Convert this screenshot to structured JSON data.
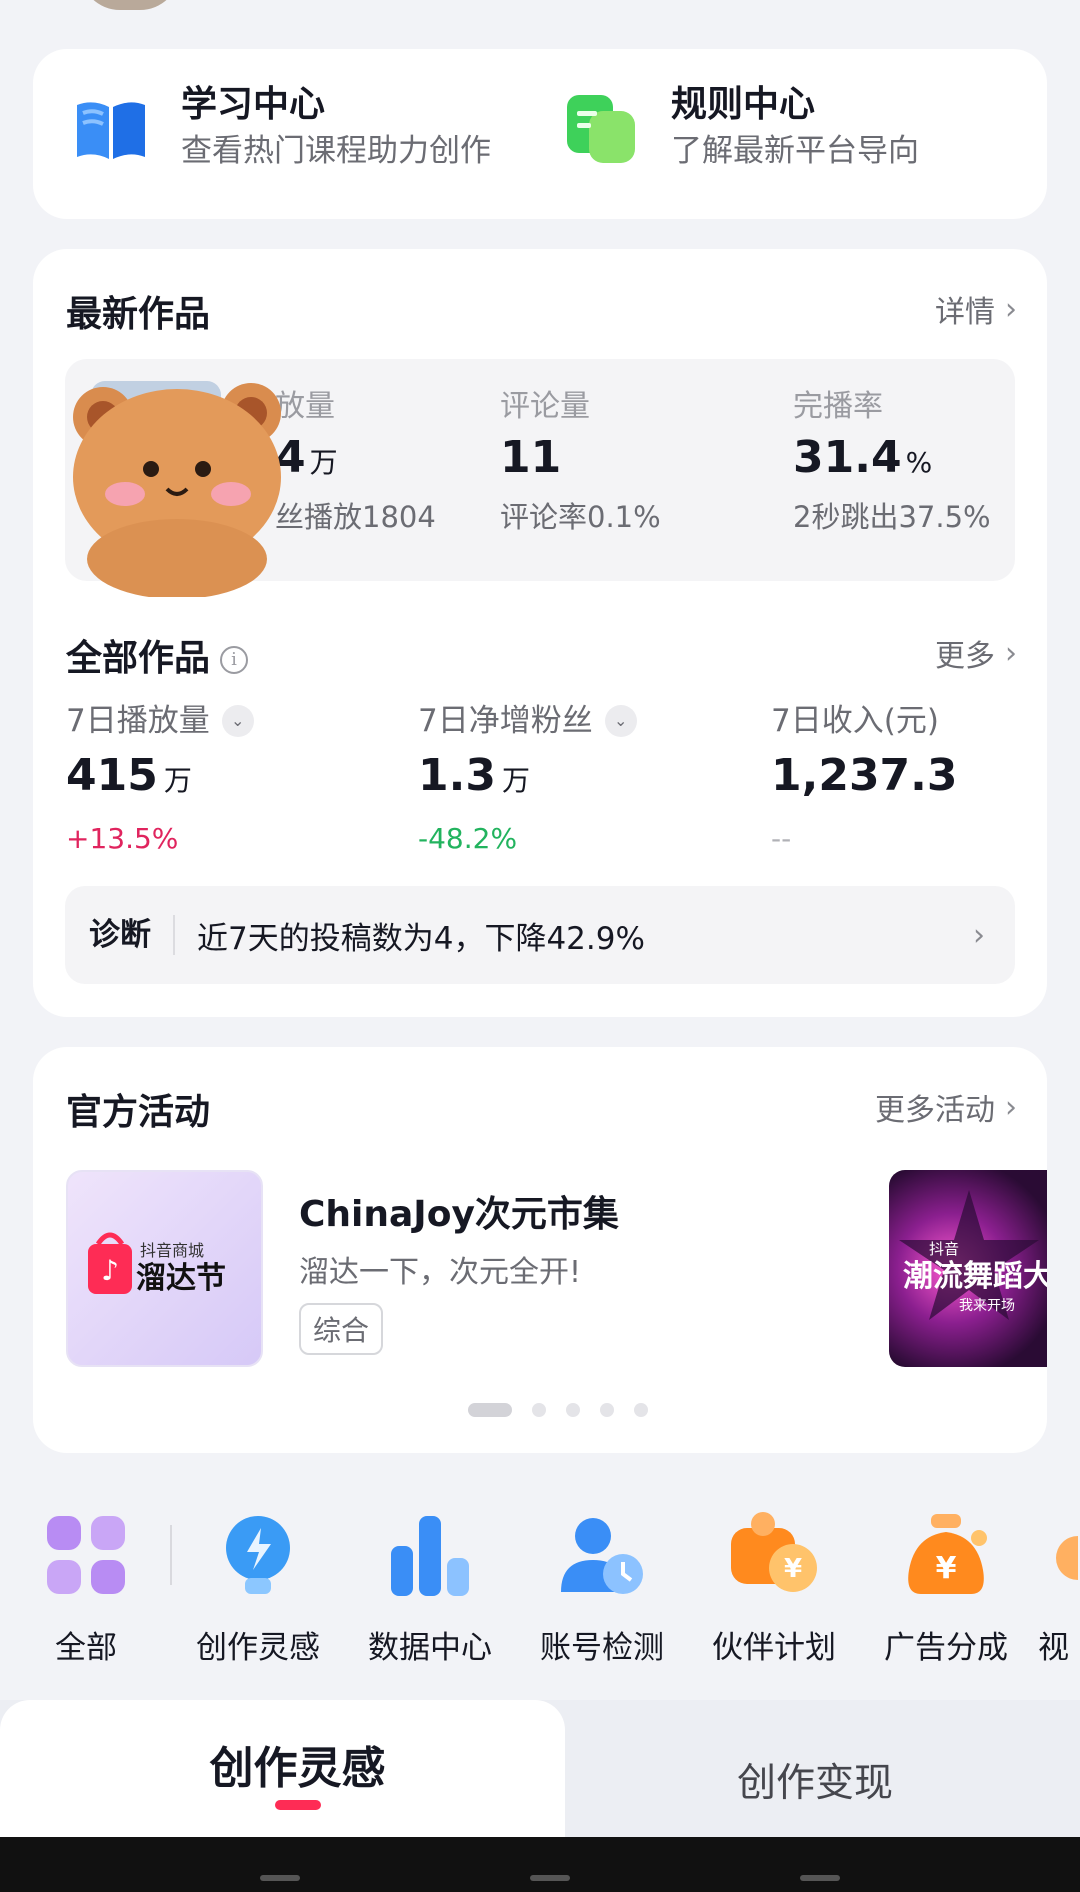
{
  "quick_links": [
    {
      "title": "学习中心",
      "subtitle": "查看热门课程助力创作",
      "icon": "book-icon"
    },
    {
      "title": "规则中心",
      "subtitle": "了解最新平台导向",
      "icon": "rules-icon"
    }
  ],
  "latest": {
    "title": "最新作品",
    "more": "详情",
    "stats": [
      {
        "label": "放量",
        "value": "4",
        "unit": "万",
        "sub": "丝播放1804"
      },
      {
        "label": "评论量",
        "value": "11",
        "unit": "",
        "sub": "评论率0.1%"
      },
      {
        "label": "完播率",
        "value": "31.4",
        "unit": "%",
        "sub": "2秒跳出37.5%"
      }
    ]
  },
  "all_works": {
    "title": "全部作品",
    "info_icon": "i",
    "more": "更多",
    "stats": [
      {
        "label": "7日播放量",
        "value": "415",
        "unit": "万",
        "change": "+13.5%",
        "change_color": "#e0245e"
      },
      {
        "label": "7日净增粉丝",
        "value": "1.3",
        "unit": "万",
        "change": "-48.2%",
        "change_color": "#22b35e"
      },
      {
        "label": "7日收入(元)",
        "value": "1,237.3",
        "unit": "",
        "change": "--",
        "change_color": "#b0b1b6"
      }
    ],
    "diagnosis": {
      "label": "诊断",
      "text": "近7天的投稿数为4，下降42.9%"
    }
  },
  "activities": {
    "title": "官方活动",
    "more": "更多活动",
    "item": {
      "title": "ChinaJoy次元市集",
      "desc": "溜达一下，次元全开!",
      "tag": "综合",
      "image_text_small": "抖音商城",
      "image_text_big": "溜达节"
    },
    "next_image_text": "潮流舞蹈大",
    "next_image_sub": "我来开场",
    "next_image_brand": "抖音",
    "pages": 5,
    "active_page": 1
  },
  "tools": [
    {
      "label": "全部",
      "icon": "grid-icon"
    },
    {
      "label": "创作灵感",
      "icon": "lightbulb-icon"
    },
    {
      "label": "数据中心",
      "icon": "bar-chart-icon"
    },
    {
      "label": "账号检测",
      "icon": "account-check-icon"
    },
    {
      "label": "伙伴计划",
      "icon": "partner-icon"
    },
    {
      "label": "广告分成",
      "icon": "money-bag-icon"
    },
    {
      "label": "视",
      "icon": "partial-icon"
    }
  ],
  "tabs": [
    {
      "label": "创作灵感",
      "active": true
    },
    {
      "label": "创作变现",
      "active": false
    }
  ],
  "colors": {
    "accent": "#fe2c55",
    "up": "#e0245e",
    "down": "#22b35e"
  }
}
